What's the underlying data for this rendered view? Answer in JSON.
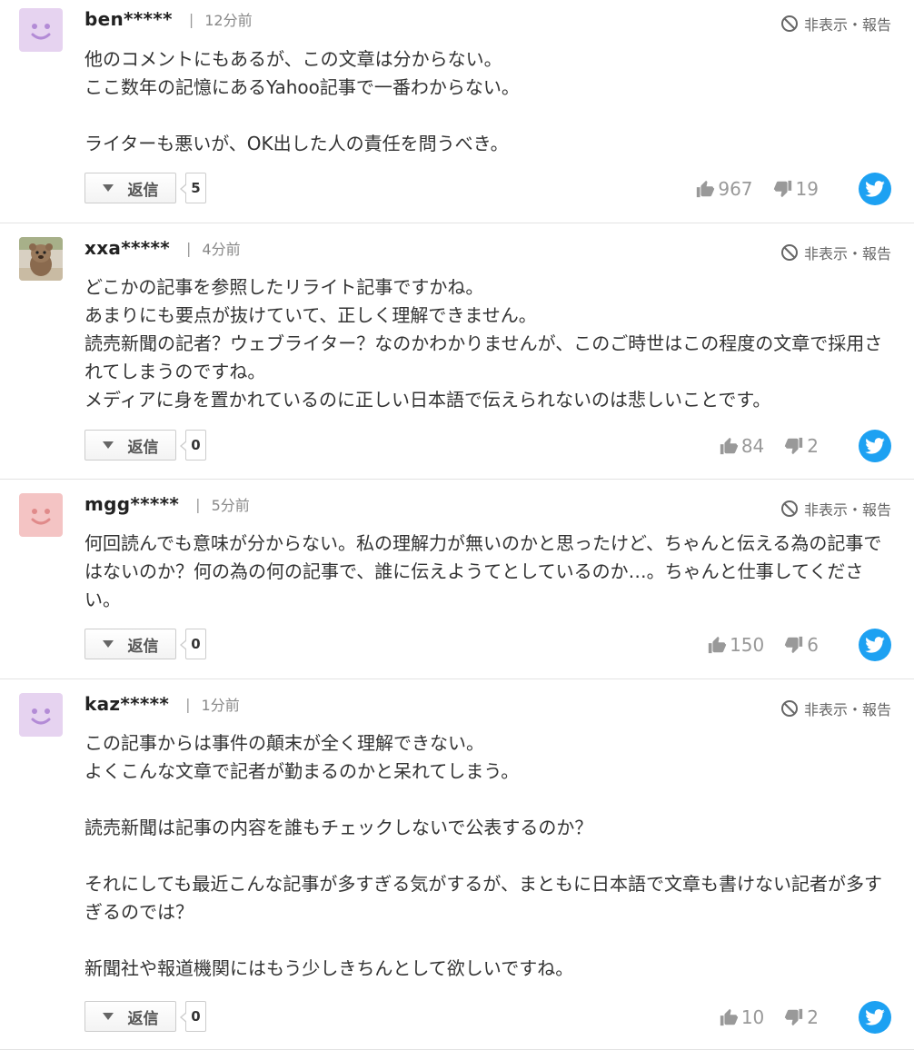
{
  "report_label": "非表示・報告",
  "reply_label": "返信",
  "comments": [
    {
      "user": "ben*****",
      "time": "12分前",
      "body": "他のコメントにもあるが、この文章は分からない。\nここ数年の記憶にあるYahoo記事で一番わからない。\n\nライターも悪いが、OK出した人の責任を問うべき。",
      "replies": "5",
      "likes": "967",
      "dislikes": "19",
      "avatar": "purple-smiley-icon"
    },
    {
      "user": "xxa*****",
      "time": "4分前",
      "body": "どこかの記事を参照したリライト記事ですかね。\nあまりにも要点が抜けていて、正しく理解できません。\n読売新聞の記者？ウェブライター？なのかわかりませんが、このご時世はこの程度の文章で採用されてしまうのですね。\nメディアに身を置かれているのに正しい日本語で伝えられないのは悲しいことです。",
      "replies": "0",
      "likes": "84",
      "dislikes": "2",
      "avatar": "quokka-photo"
    },
    {
      "user": "mgg*****",
      "time": "5分前",
      "body": "何回読んでも意味が分からない。私の理解力が無いのかと思ったけど、ちゃんと伝える為の記事ではないのか？何の為の何の記事で、誰に伝えようてとしているのか…。ちゃんと仕事してください。",
      "replies": "0",
      "likes": "150",
      "dislikes": "6",
      "avatar": "pink-smiley-icon"
    },
    {
      "user": "kaz*****",
      "time": "1分前",
      "body": "この記事からは事件の顛末が全く理解できない。\nよくこんな文章で記者が勤まるのかと呆れてしまう。\n\n読売新聞は記事の内容を誰もチェックしないで公表するのか？\n\nそれにしても最近こんな記事が多すぎる気がするが、まともに日本語で文章も書けない記者が多すぎるのでは？\n\n新聞社や報道機関にはもう少しきちんとして欲しいですね。",
      "replies": "0",
      "likes": "10",
      "dislikes": "2",
      "avatar": "purple-smiley-icon"
    }
  ],
  "colors": {
    "purple_avatar_bg": "#e6d3f0",
    "purple_avatar_face": "#b38bd6",
    "pink_avatar_bg": "#f4c4c4",
    "pink_avatar_face": "#e08a8a",
    "twitter": "#1da1f2",
    "vote_gray": "#999999"
  }
}
